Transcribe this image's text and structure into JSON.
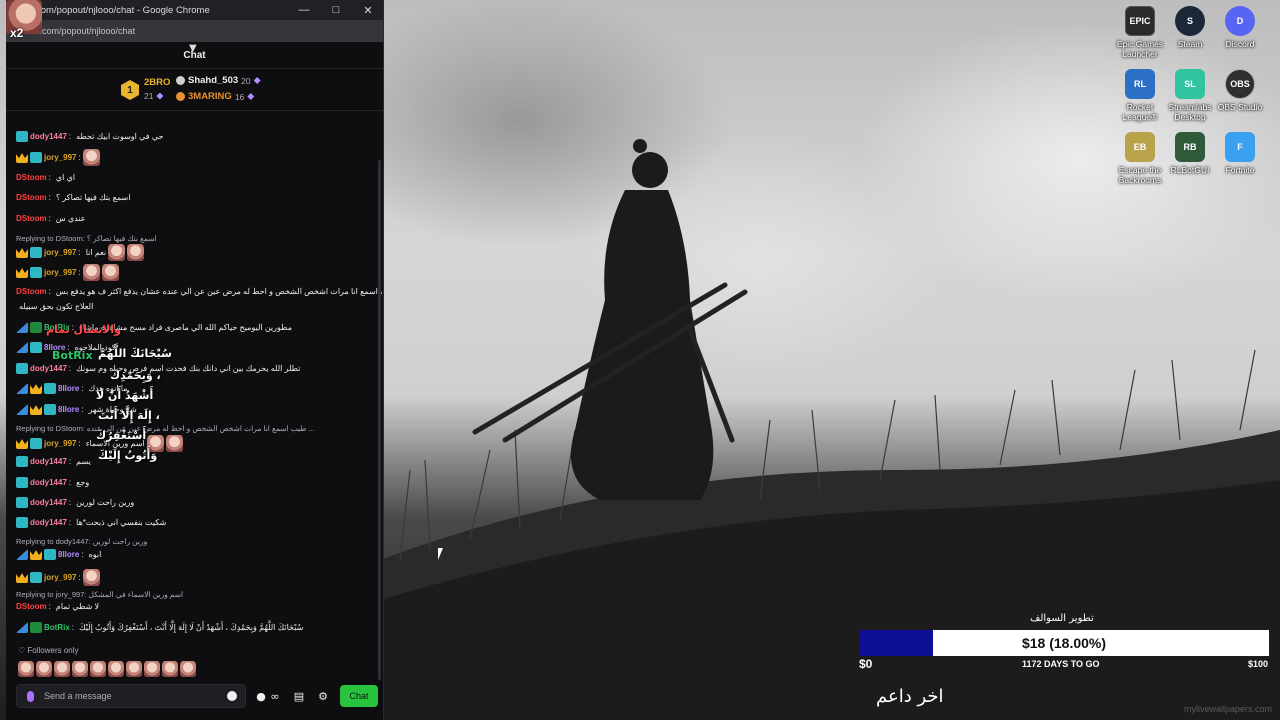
{
  "browser": {
    "title": "com/popout/njlooo/chat - Google Chrome",
    "address": "tck.com/popout/njlooo/chat",
    "minimize_icon": "minimize-icon",
    "maximize_icon": "maximize-icon",
    "close_icon": "close-icon"
  },
  "overlay": {
    "multiplier": "x2"
  },
  "chat": {
    "header": "Chat",
    "leaderboard": {
      "rank": "1",
      "entries": [
        {
          "name": "2BRO",
          "score": "21",
          "color": "#e8b52e"
        },
        {
          "name": "Shahd_503",
          "score": "20",
          "color": "#efeff1"
        },
        {
          "name": "3MARING",
          "score": "16",
          "color": "#e8912e"
        }
      ]
    },
    "messages": [
      {
        "user": "dody1447",
        "color": "#ff7f9e",
        "text": "حي في اوسوت ابيك تحطه"
      },
      {
        "user": "jory_997",
        "color": "#daa520",
        "text": ""
      },
      {
        "user": "DStoom",
        "color": "#ff4040",
        "text": "اي اي"
      },
      {
        "user": "DStoom",
        "color": "#ff4040",
        "text": "اسمع بتك فيها تصاكر ؟"
      },
      {
        "user": "DStoom",
        "color": "#ff4040",
        "text": "عندي س"
      },
      {
        "reply": "Replying to DStoom: اسمع بتك فيها تصاكر ؟"
      },
      {
        "user": "jory_997",
        "color": "#daa520",
        "text": "نعم انا"
      },
      {
        "user": "jory_997",
        "color": "#daa520",
        "text": ""
      },
      {
        "user": "DStoom",
        "color": "#ff4040",
        "text": "طيب اسمع انا مرات اشخص الشخص و احط له مرض عين عن الي عنده عشان يدفع اكثر ف هو يدفع بس"
      },
      {
        "text": "العلاج تكون بحق سبيله"
      },
      {
        "user": "BotRix",
        "color": "#2fc46a",
        "text": "مطورين اليوميح حياكم الله الي ماصرى فراد مسح مشاهده ماشاء"
      },
      {
        "user": "8llore",
        "color": "#b48cff",
        "text": "كود الملاحوه"
      },
      {
        "user": "dody1447",
        "color": "#ff7f9e",
        "text": "تطلر الله يحرمك بين اني دانك بنك فحدت اسم فرص وحياه وم سونك"
      },
      {
        "user": "8llore",
        "color": "#b48cff",
        "text": "ما انوه هدك"
      },
      {
        "user": "8llore",
        "color": "#b48cff",
        "text": "شع وحياة شهر"
      },
      {
        "reply": "Replying to DStoom: طيب اسمع انا مرات اشخص الشخص و احط له مرض عين عن الي عنده ..."
      },
      {
        "user": "jory_997",
        "color": "#daa520",
        "text": "اسم ورين الاسماء"
      },
      {
        "user": "dody1447",
        "color": "#ff7f9e",
        "text": "يسم"
      },
      {
        "user": "dody1447",
        "color": "#ff7f9e",
        "text": "وجع"
      },
      {
        "user": "dody1447",
        "color": "#ff7f9e",
        "text": "ورين راحت لورين"
      },
      {
        "user": "dody1447",
        "color": "#ff7f9e",
        "text": "شكيت بنفسي اني ذبحت*ها"
      },
      {
        "reply": "Replying to dody1447: ورين راحت لورين"
      },
      {
        "user": "8llore",
        "color": "#b48cff",
        "text": "ابوه"
      },
      {
        "user": "jory_997",
        "color": "#daa520",
        "text": ""
      },
      {
        "reply": "Replying to jory_997: اسم ورين الاسماء في المشكل"
      },
      {
        "user": "DStoom",
        "color": "#ff4040",
        "text": "لا شطي تمام"
      },
      {
        "user": "BotRix",
        "color": "#2fc46a",
        "text": "سُبْحَانَكَ اللَّهُمَّ وَبِحَمْدِكَ ، أَشْهَدُ أَنْ لَا إِلَهَ إِلَّا أَنْتَ ، أَسْتَغْفِرُكَ وَأَتُوبُ إِلَيْكَ"
      }
    ],
    "alert": {
      "lines": [
        "سُبْحَانَكَ اللَّهُمَّ",
        "وَبِحَمْدِكَ ،",
        "أَشْهَدُ أَنْ لَا",
        "إِلَهَ إِلَّا أَنْتَ ،",
        "أَسْتَغْفِرُكَ",
        "وَأَتُوبُ إِلَيْكَ"
      ],
      "user": "BotRix",
      "header": "والاتصال تمام"
    },
    "followers_only": "Followers only",
    "input_placeholder": "Send a message",
    "chat_button": "Chat"
  },
  "desktop_icons": [
    {
      "label": "Epic Games Launcher",
      "icon": "epic-games-icon",
      "badge": "EPIC",
      "color": "#2a2a2a"
    },
    {
      "label": "Steam",
      "icon": "steam-icon",
      "badge": "S",
      "color": "#1b2838"
    },
    {
      "label": "Discord",
      "icon": "discord-icon",
      "badge": "D",
      "color": "#5865f2"
    },
    {
      "label": "Rocket League®",
      "icon": "rocket-league-icon",
      "badge": "RL",
      "color": "#2d6fc4"
    },
    {
      "label": "Streamlabs Desktop",
      "icon": "streamlabs-icon",
      "badge": "SL",
      "color": "#31c3a2"
    },
    {
      "label": "OBS Studio",
      "icon": "obs-icon",
      "badge": "OBS",
      "color": "#302e31"
    },
    {
      "label": "Escape the Backrooms",
      "icon": "escape-backrooms-icon",
      "badge": "EB",
      "color": "#b8a24a"
    },
    {
      "label": "RLBotGUI",
      "icon": "rlbot-icon",
      "badge": "RB",
      "color": "#2f5a3a"
    },
    {
      "label": "Fortnite",
      "icon": "fortnite-icon",
      "badge": "F",
      "color": "#3aa0f0"
    }
  ],
  "goal": {
    "title": "تطوير السوالف",
    "amount_text": "$18 (18.00%)",
    "progress": 0.18,
    "min_label": "$0",
    "days_left": "1172 DAYS TO GO",
    "max_label": "$100",
    "fill_color": "#0f0f96"
  },
  "last_donor": "اخر داعم",
  "watermark": "mylivewallpapers.com"
}
